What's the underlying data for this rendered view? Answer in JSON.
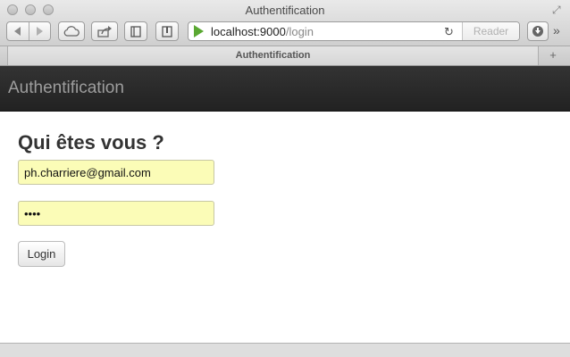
{
  "browser": {
    "window_title": "Authentification",
    "tab_title": "Authentification",
    "url_host": "localhost:9000",
    "url_path": "/login",
    "reader_label": "Reader",
    "new_tab_label": "+"
  },
  "page": {
    "brand": "Authentification",
    "heading": "Qui êtes vous ?",
    "email_value": "ph.charriere@gmail.com",
    "password_value": "••••",
    "login_label": "Login"
  },
  "colors": {
    "autofill_bg": "#fbfcb7",
    "navbar_bg": "#222222",
    "play_icon": "#5aa832"
  }
}
